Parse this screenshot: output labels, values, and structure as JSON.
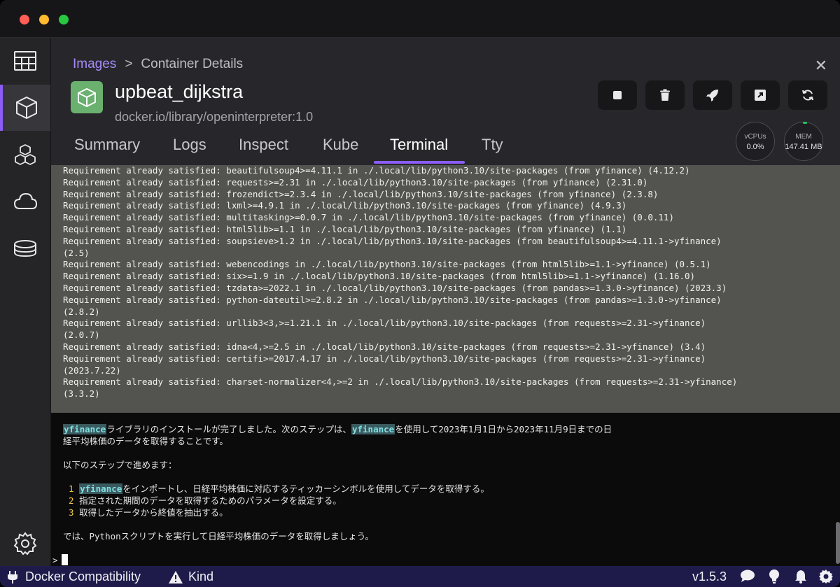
{
  "breadcrumb": {
    "parent": "Images",
    "separator": ">",
    "current": "Container Details"
  },
  "container": {
    "name": "upbeat_dijkstra",
    "image": "docker.io/library/openinterpreter:1.0"
  },
  "stats": {
    "cpu_label": "vCPUs",
    "cpu_value": "0.0%",
    "mem_label": "MEM",
    "mem_value": "147.41 MB"
  },
  "tabs": [
    {
      "label": "Summary"
    },
    {
      "label": "Logs"
    },
    {
      "label": "Inspect"
    },
    {
      "label": "Kube"
    },
    {
      "label": "Terminal",
      "active": true
    },
    {
      "label": "Tty"
    }
  ],
  "actions": [
    "stop-icon",
    "trash-icon",
    "rocket-icon",
    "external-link-icon",
    "refresh-icon"
  ],
  "sidebar": [
    "dashboard-icon",
    "containers-icon",
    "pods-icon",
    "cloud-icon",
    "volumes-icon",
    "settings-icon"
  ],
  "terminal": {
    "pip_lines": [
      "Requirement already satisfied: beautifulsoup4>=4.11.1 in ./.local/lib/python3.10/site-packages (from yfinance) (4.12.2)",
      "Requirement already satisfied: requests>=2.31 in ./.local/lib/python3.10/site-packages (from yfinance) (2.31.0)",
      "Requirement already satisfied: frozendict>=2.3.4 in ./.local/lib/python3.10/site-packages (from yfinance) (2.3.8)",
      "Requirement already satisfied: lxml>=4.9.1 in ./.local/lib/python3.10/site-packages (from yfinance) (4.9.3)",
      "Requirement already satisfied: multitasking>=0.0.7 in ./.local/lib/python3.10/site-packages (from yfinance) (0.0.11)",
      "Requirement already satisfied: html5lib>=1.1 in ./.local/lib/python3.10/site-packages (from yfinance) (1.1)",
      "Requirement already satisfied: soupsieve>1.2 in ./.local/lib/python3.10/site-packages (from beautifulsoup4>=4.11.1->yfinance)",
      "(2.5)",
      "Requirement already satisfied: webencodings in ./.local/lib/python3.10/site-packages (from html5lib>=1.1->yfinance) (0.5.1)",
      "Requirement already satisfied: six>=1.9 in ./.local/lib/python3.10/site-packages (from html5lib>=1.1->yfinance) (1.16.0)",
      "Requirement already satisfied: tzdata>=2022.1 in ./.local/lib/python3.10/site-packages (from pandas>=1.3.0->yfinance) (2023.3)",
      "Requirement already satisfied: python-dateutil>=2.8.2 in ./.local/lib/python3.10/site-packages (from pandas>=1.3.0->yfinance)",
      "(2.8.2)",
      "Requirement already satisfied: urllib3<3,>=1.21.1 in ./.local/lib/python3.10/site-packages (from requests>=2.31->yfinance)",
      "(2.0.7)",
      "Requirement already satisfied: idna<4,>=2.5 in ./.local/lib/python3.10/site-packages (from requests>=2.31->yfinance) (3.4)",
      "Requirement already satisfied: certifi>=2017.4.17 in ./.local/lib/python3.10/site-packages (from requests>=2.31->yfinance)",
      "(2023.7.22)",
      "Requirement already satisfied: charset-normalizer<4,>=2 in ./.local/lib/python3.10/site-packages (from requests>=2.31->yfinance)",
      "(3.3.2)"
    ],
    "msg1_hl": "yfinance",
    "msg1_a": "ライブラリのインストールが完了しました。次のステップは、",
    "msg1_hl2": "yfinance",
    "msg1_b": "を使用して2023年1月1日から2023年11月9日までの日",
    "msg1_c": "経平均株価のデータを取得することです。",
    "msg2": "以下のステップで進めます：",
    "steps": [
      {
        "num": "1",
        "hl": "yfinance",
        "text": "をインポートし、日経平均株価に対応するティッカーシンボルを使用してデータを取得する。"
      },
      {
        "num": "2",
        "hl": "",
        "text": "指定された期間のデータを取得するためのパラメータを設定する。"
      },
      {
        "num": "3",
        "hl": "",
        "text": "取得したデータから終値を抽出する。"
      }
    ],
    "msg3": "では、Pythonスクリプトを実行して日経平均株価のデータを取得しましょう。",
    "prompt": ">"
  },
  "statusbar": {
    "docker_compat": "Docker Compatibility",
    "kind": "Kind",
    "version": "v1.5.3"
  }
}
